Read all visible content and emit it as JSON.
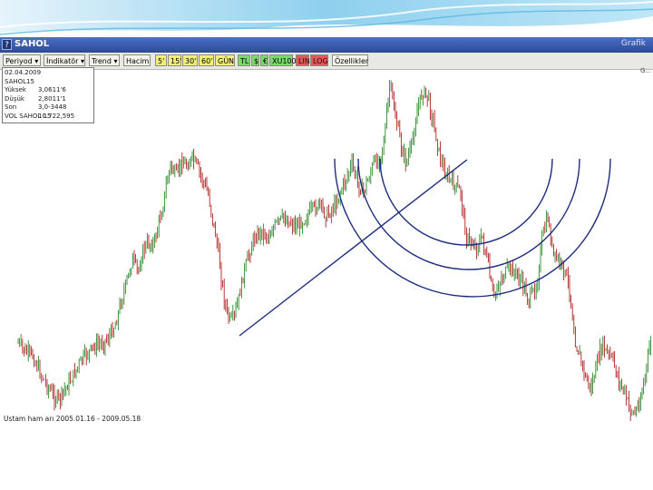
{
  "window": {
    "title": "SAHOL",
    "right_label": "Grafik",
    "menu_icon": "question-icon",
    "corner_label": "G..."
  },
  "toolbar": {
    "buttons": [
      {
        "label": "Periyod ▾",
        "style": "normal"
      },
      {
        "label": "İndikatör ▾",
        "style": "normal"
      },
      {
        "label": "Trend ▾",
        "style": "normal"
      },
      {
        "label": "Hacim",
        "style": "normal"
      },
      {
        "label": "5'",
        "style": "yellow"
      },
      {
        "label": "15'",
        "style": "yellow"
      },
      {
        "label": "30'",
        "style": "yellow"
      },
      {
        "label": "60'",
        "style": "yellow"
      },
      {
        "label": "GÜN",
        "style": "yellow"
      },
      {
        "label": "TL",
        "style": "green"
      },
      {
        "label": "$",
        "style": "green"
      },
      {
        "label": "€",
        "style": "green"
      },
      {
        "label": "XU100",
        "style": "green"
      },
      {
        "label": "LIN",
        "style": "red"
      },
      {
        "label": "LOG",
        "style": "red"
      },
      {
        "label": "Özellikler",
        "style": "normal"
      }
    ]
  },
  "info": {
    "rows": [
      {
        "k": "02.04.2009",
        "v": ""
      },
      {
        "k": "SAHOL15",
        "v": ""
      },
      {
        "k": "Yüksek",
        "v": "3,0611'6"
      },
      {
        "k": "Düşük",
        "v": "2,8011'1"
      },
      {
        "k": "Son",
        "v": "3,0-3448"
      },
      {
        "k": "VOL SAHOL 15",
        "v": "10.722,595"
      }
    ]
  },
  "footer": "Ustam ham arı 2005.01.16 - 2009.05.18",
  "chart_data": {
    "type": "candlestick",
    "colors": {
      "up": "#2a8a2a",
      "down": "#b02020",
      "drawing": "#1c2c7c"
    },
    "series": [
      {
        "name": "SAHOL"
      }
    ],
    "price_path": [
      [
        20,
        378
      ],
      [
        28,
        388
      ],
      [
        36,
        392
      ],
      [
        44,
        410
      ],
      [
        52,
        425
      ],
      [
        60,
        438
      ],
      [
        66,
        440
      ],
      [
        72,
        428
      ],
      [
        80,
        415
      ],
      [
        88,
        400
      ],
      [
        96,
        390
      ],
      [
        104,
        382
      ],
      [
        112,
        378
      ],
      [
        120,
        372
      ],
      [
        128,
        355
      ],
      [
        134,
        330
      ],
      [
        140,
        310
      ],
      [
        146,
        285
      ],
      [
        152,
        300
      ],
      [
        158,
        275
      ],
      [
        164,
        268
      ],
      [
        170,
        268
      ],
      [
        174,
        250
      ],
      [
        180,
        225
      ],
      [
        184,
        200
      ],
      [
        188,
        182
      ],
      [
        194,
        195
      ],
      [
        200,
        178
      ],
      [
        206,
        182
      ],
      [
        212,
        175
      ],
      [
        218,
        185
      ],
      [
        224,
        200
      ],
      [
        230,
        215
      ],
      [
        234,
        240
      ],
      [
        238,
        260
      ],
      [
        242,
        290
      ],
      [
        246,
        320
      ],
      [
        250,
        345
      ],
      [
        254,
        355
      ],
      [
        258,
        350
      ],
      [
        262,
        335
      ],
      [
        268,
        305
      ],
      [
        274,
        282
      ],
      [
        280,
        262
      ],
      [
        288,
        255
      ],
      [
        296,
        260
      ],
      [
        304,
        248
      ],
      [
        312,
        240
      ],
      [
        320,
        245
      ],
      [
        328,
        250
      ],
      [
        336,
        240
      ],
      [
        344,
        232
      ],
      [
        352,
        225
      ],
      [
        360,
        238
      ],
      [
        368,
        228
      ],
      [
        376,
        210
      ],
      [
        382,
        195
      ],
      [
        388,
        182
      ],
      [
        394,
        200
      ],
      [
        400,
        212
      ],
      [
        406,
        198
      ],
      [
        412,
        180
      ],
      [
        418,
        176
      ],
      [
        424,
        150
      ],
      [
        430,
        92
      ],
      [
        436,
        128
      ],
      [
        442,
        160
      ],
      [
        448,
        180
      ],
      [
        454,
        160
      ],
      [
        460,
        122
      ],
      [
        466,
        100
      ],
      [
        472,
        108
      ],
      [
        478,
        135
      ],
      [
        484,
        168
      ],
      [
        490,
        190
      ],
      [
        496,
        198
      ],
      [
        502,
        206
      ],
      [
        508,
        212
      ],
      [
        514,
        262
      ],
      [
        520,
        268
      ],
      [
        526,
        272
      ],
      [
        532,
        262
      ],
      [
        538,
        292
      ],
      [
        544,
        330
      ],
      [
        550,
        312
      ],
      [
        556,
        302
      ],
      [
        562,
        296
      ],
      [
        568,
        300
      ],
      [
        576,
        312
      ],
      [
        584,
        332
      ],
      [
        592,
        312
      ],
      [
        598,
        262
      ],
      [
        604,
        240
      ],
      [
        610,
        282
      ],
      [
        616,
        288
      ],
      [
        622,
        298
      ],
      [
        628,
        318
      ],
      [
        634,
        375
      ],
      [
        640,
        395
      ],
      [
        646,
        418
      ],
      [
        652,
        428
      ],
      [
        658,
        402
      ],
      [
        664,
        380
      ],
      [
        670,
        390
      ],
      [
        676,
        398
      ],
      [
        682,
        418
      ],
      [
        688,
        432
      ],
      [
        694,
        450
      ],
      [
        700,
        456
      ],
      [
        706,
        440
      ],
      [
        712,
        410
      ],
      [
        718,
        372
      ]
    ],
    "drawings": [
      {
        "type": "trendline",
        "from": [
          264,
          370
        ],
        "to": [
          515,
          176
        ]
      },
      {
        "type": "speed-arcs",
        "cx": [
          514,
          517,
          521
        ],
        "cy": [
          175,
          175,
          175
        ],
        "r": [
          95,
          122,
          152
        ]
      }
    ]
  }
}
